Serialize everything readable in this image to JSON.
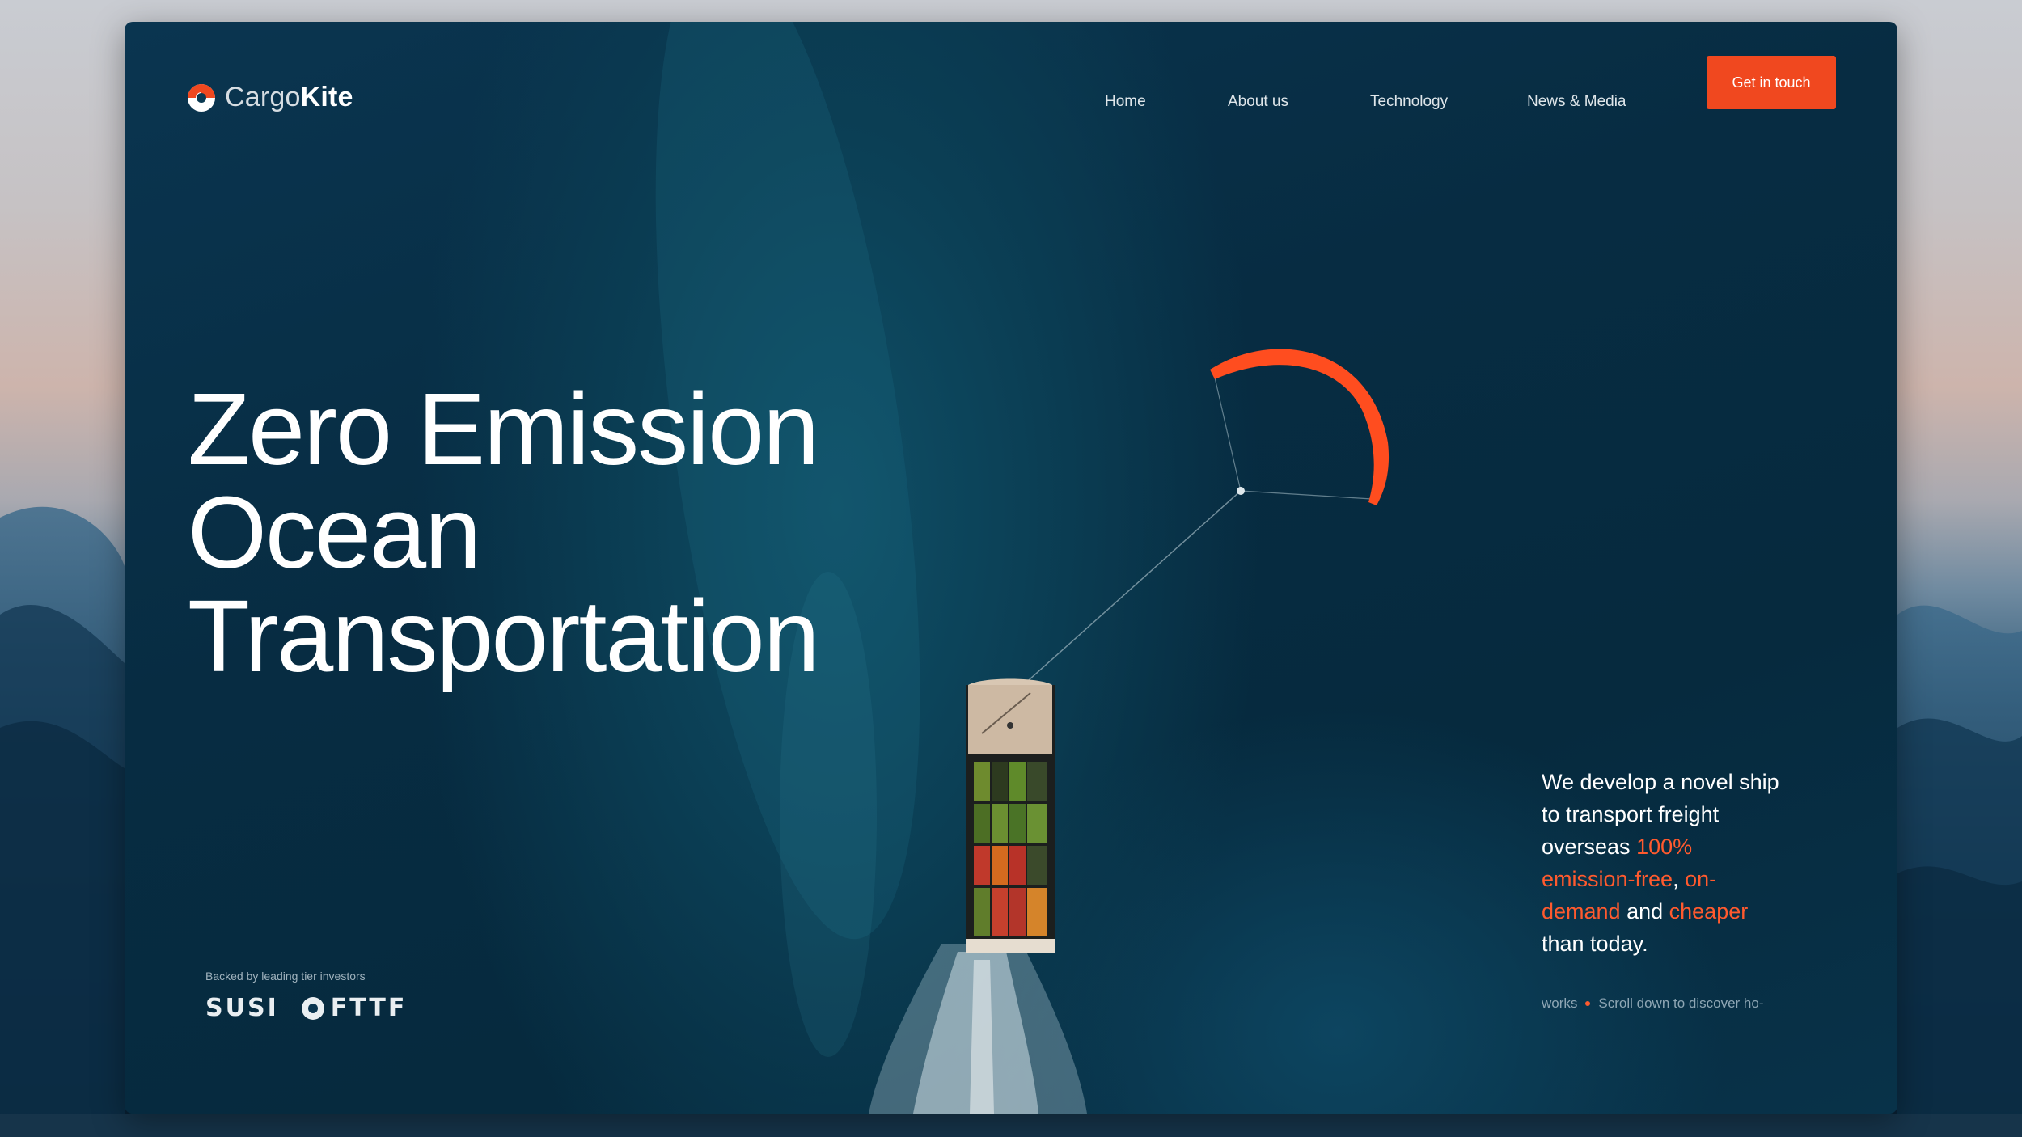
{
  "brand": {
    "name_light": "Cargo",
    "name_bold": "Kite",
    "logo_icon": "cargokite-logo-icon",
    "accent_color": "#f0481f"
  },
  "nav": {
    "items": [
      {
        "label": "Home"
      },
      {
        "label": "About us"
      },
      {
        "label": "Technology"
      },
      {
        "label": "News & Media"
      }
    ],
    "cta_label": "Get in touch"
  },
  "hero": {
    "headline_lines": [
      "Zero Emission",
      "Ocean",
      "Transportation"
    ],
    "tagline": {
      "part1": "We develop a novel ship to transport freight overseas ",
      "hl1": "100% emission-free",
      "part2": ", ",
      "hl2": "on-demand",
      "part3": " and ",
      "hl3": "cheaper",
      "part4": " than today."
    },
    "scroll_hint": {
      "left": "works",
      "right": "Scroll down to discover ho-"
    }
  },
  "backed": {
    "label": "Backed by leading tier investors",
    "sponsors": [
      "SUSI",
      "FTTF"
    ]
  }
}
